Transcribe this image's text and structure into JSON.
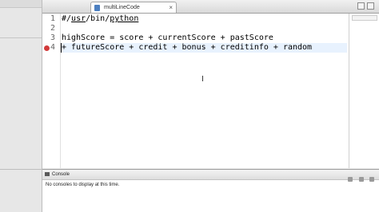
{
  "tabs": {
    "inactive_label": "",
    "active_label": "multiLineCode",
    "close_glyph": "×"
  },
  "editor": {
    "line_numbers": [
      "1",
      "2",
      "3",
      "4"
    ],
    "lines": [
      {
        "text_prefix": "#/",
        "text_underlined1": "usr",
        "text_mid": "/bin/",
        "text_underlined2": "python"
      },
      {
        "text": ""
      },
      {
        "text": "highScore = score + currentScore + pastScore"
      },
      {
        "text": "+ futureScore + credit + bonus + creditinfo + random"
      }
    ],
    "error_line": "4"
  },
  "console": {
    "tab_label": "Console",
    "message": "No consoles to display at this time."
  },
  "colors": {
    "error": "#d23a3a",
    "current_line": "#e8f2fe"
  }
}
